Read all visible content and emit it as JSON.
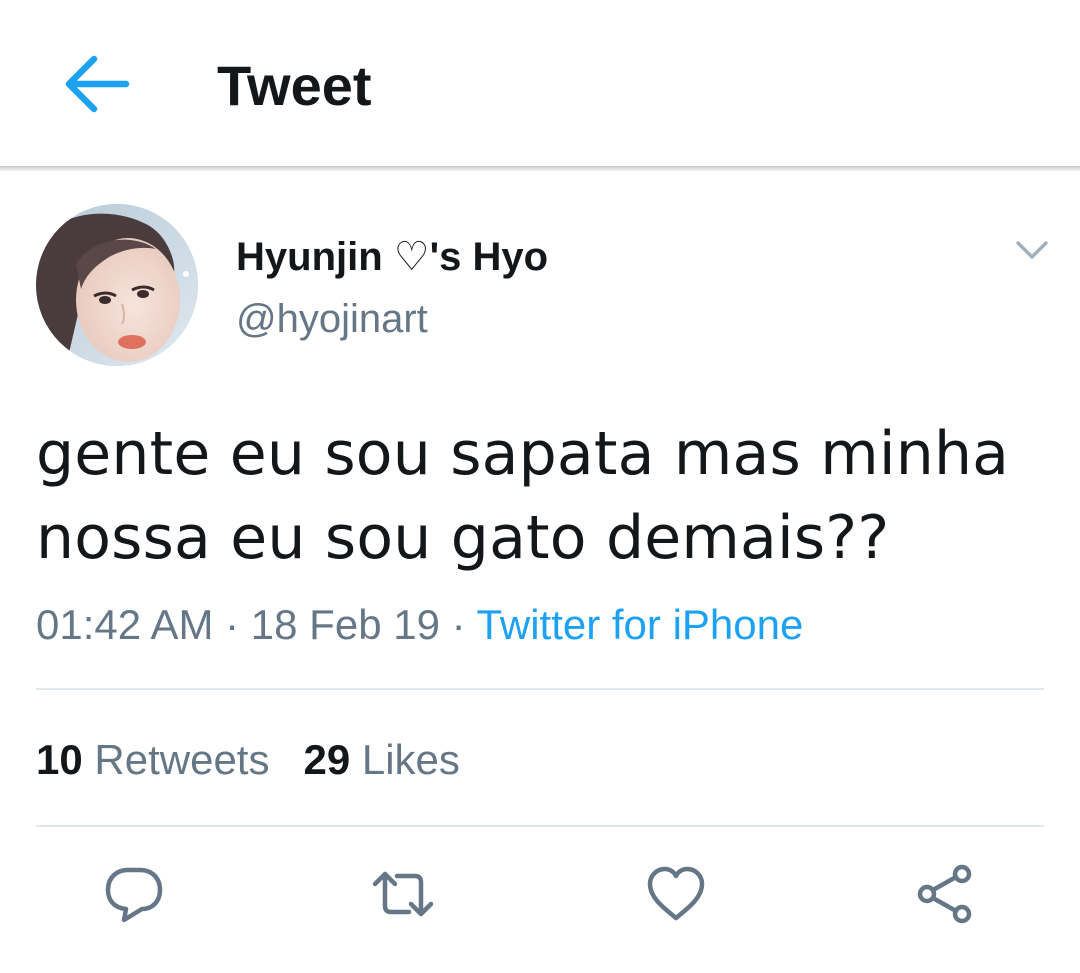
{
  "header": {
    "title": "Tweet",
    "back_icon": "arrow-left-icon"
  },
  "tweet": {
    "author": {
      "display_name": "Hyunjin ♡'s Hyo",
      "username": "@hyojinart",
      "avatar": "profile-photo"
    },
    "text_lines": [
      "gente eu sou sapata mas minha",
      "nossa eu sou gato demais??"
    ],
    "time": "01:42 AM",
    "separator": " · ",
    "date": "18 Feb 19",
    "source": "Twitter for iPhone",
    "stats": {
      "retweets_count": "10",
      "retweets_label": "Retweets",
      "likes_count": "29",
      "likes_label": "Likes"
    },
    "actions": [
      "reply-icon",
      "retweet-icon",
      "heart-icon",
      "share-icon"
    ]
  },
  "colors": {
    "accent": "#1da1f2",
    "text_primary": "#14171a",
    "text_secondary": "#657786",
    "divider": "#e1e8ed",
    "icon_gray": "#657786"
  }
}
